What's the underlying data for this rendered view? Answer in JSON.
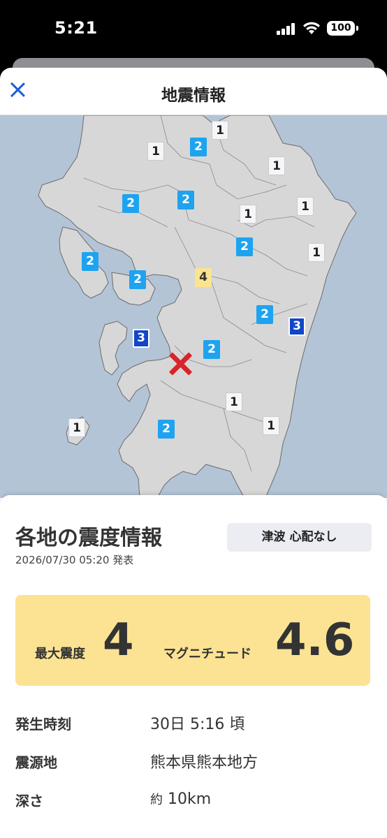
{
  "status": {
    "time": "5:21",
    "battery": "100"
  },
  "header": {
    "title": "地震情報",
    "close_icon": "close-icon"
  },
  "map": {
    "epicenter_icon": "epicenter-x-icon",
    "badges": [
      "1",
      "1",
      "2",
      "1",
      "2",
      "2",
      "1",
      "1",
      "2",
      "1",
      "2",
      "2",
      "4",
      "2",
      "3",
      "3",
      "2",
      "1",
      "1",
      "1",
      "2"
    ]
  },
  "info": {
    "title": "各地の震度情報",
    "issued": "2026/07/30 05:20 発表",
    "tsunami": "津波 心配なし",
    "max_intensity_label": "最大震度",
    "max_intensity_value": "4",
    "magnitude_label": "マグニチュード",
    "magnitude_value": "4.6",
    "rows": [
      {
        "label": "発生時刻",
        "value": "30日 5:16 頃"
      },
      {
        "label": "震源地",
        "value": "熊本県熊本地方"
      },
      {
        "label": "深さ",
        "prefix": "約",
        "value": "10km"
      }
    ]
  },
  "colors": {
    "intensity1": "#f6f6f8",
    "intensity2": "#1ea3f0",
    "intensity3": "#1146c8",
    "intensity4": "#fce48e",
    "epicenter": "#d8242a",
    "summary_bg": "#fbe393",
    "accent": "#1a5fd6"
  }
}
